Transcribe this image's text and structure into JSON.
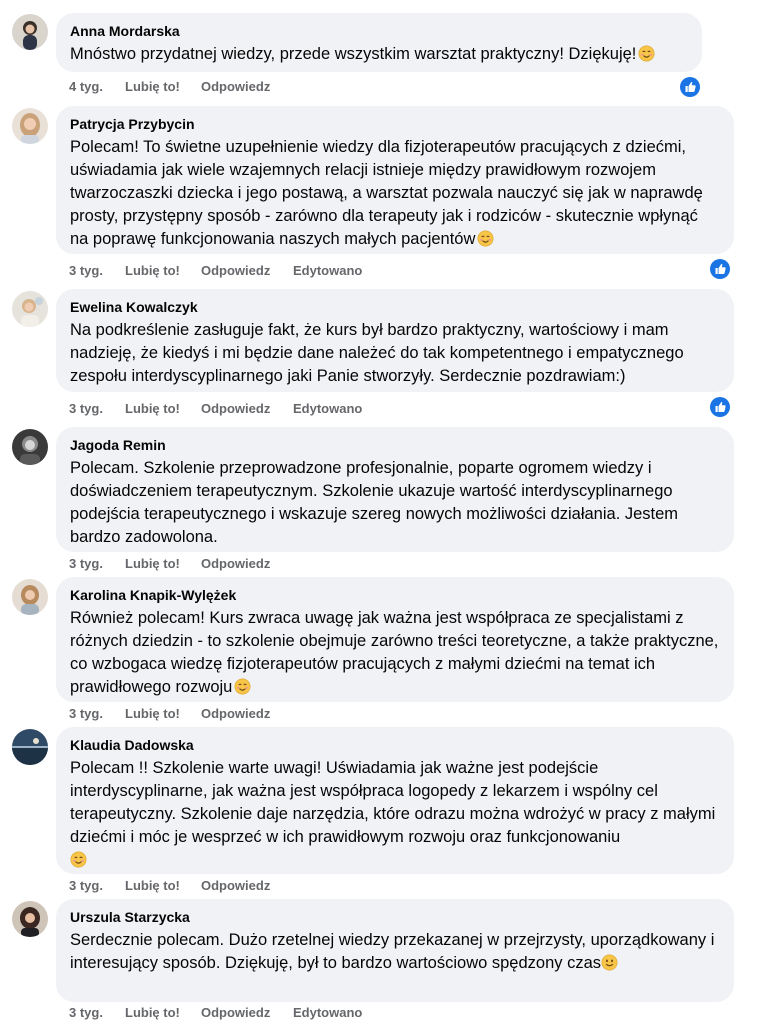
{
  "comments": [
    {
      "author": "Anna Mordarska",
      "text": "Mnóstwo przydatnej wiedzy, przede wszystkim warsztat praktyczny! Dziękuję!",
      "emoji": "smiling-face-icon",
      "time": "4 tyg.",
      "like_label": "Lubię to!",
      "reply_label": "Odpowiedz",
      "edited_label": "",
      "liked": true
    },
    {
      "author": "Patrycja Przybycin",
      "text": "Polecam! To świetne uzupełnienie wiedzy dla fizjoterapeutów pracujących z dziećmi, uświadamia jak wiele wzajemnych relacji istnieje między prawidłowym rozwojem twarzoczaszki dziecka i jego postawą, a warsztat pozwala nauczyć się jak w naprawdę prosty, przystępny sposób - zarówno dla terapeuty jak i rodziców - skutecznie wpłynąć na poprawę funkcjonowania naszych małych pacjentów",
      "emoji": "smiling-face-icon",
      "time": "3 tyg.",
      "like_label": "Lubię to!",
      "reply_label": "Odpowiedz",
      "edited_label": "Edytowano",
      "liked": true
    },
    {
      "author": "Ewelina Kowalczyk",
      "text": "Na podkreślenie zasługuje fakt, że kurs był bardzo praktyczny, wartościowy i mam nadzieję, że kiedyś i mi będzie dane należeć do tak kompetentnego i empatycznego zespołu interdyscyplinarnego jaki Panie stworzyły. Serdecznie pozdrawiam:)",
      "emoji": "",
      "time": "3 tyg.",
      "like_label": "Lubię to!",
      "reply_label": "Odpowiedz",
      "edited_label": "Edytowano",
      "liked": true
    },
    {
      "author": "Jagoda Remin",
      "text": "Polecam. Szkolenie przeprowadzone profesjonalnie, poparte ogromem wiedzy i doświadczeniem terapeutycznym. Szkolenie ukazuje wartość interdyscyplinarnego podejścia terapeutycznego i wskazuje szereg nowych możliwości działania. Jestem bardzo zadowolona.",
      "emoji": "",
      "time": "3 tyg.",
      "like_label": "Lubię to!",
      "reply_label": "Odpowiedz",
      "edited_label": "",
      "liked": false
    },
    {
      "author": "Karolina Knapik-Wylężek",
      "text": "Również polecam! Kurs zwraca uwagę jak ważna jest współpraca ze specjalistami z różnych dziedzin - to szkolenie obejmuje zarówno treści teoretyczne, a także praktyczne, co wzbogaca wiedzę fizjoterapeutów pracujących z małymi dziećmi na temat ich prawidłowego rozwoju",
      "emoji": "smiling-face-icon",
      "time": "3 tyg.",
      "like_label": "Lubię to!",
      "reply_label": "Odpowiedz",
      "edited_label": "",
      "liked": false
    },
    {
      "author": "Klaudia Dadowska",
      "text": "Polecam !! Szkolenie warte uwagi! Uświadamia jak ważne jest podejście interdyscyplinarne, jak ważna jest współpraca logopedy z lekarzem i wspólny cel terapeutyczny. Szkolenie daje narzędzia, które odrazu można wdrożyć w pracy z małymi dziećmi i móc je wesprzeć w ich prawidłowym rozwoju oraz funkcjonowaniu",
      "emoji": "smiling-face-icon",
      "time": "3 tyg.",
      "like_label": "Lubię to!",
      "reply_label": "Odpowiedz",
      "edited_label": "",
      "liked": false
    },
    {
      "author": "Urszula Starzycka",
      "text": "Serdecznie polecam. Dużo rzetelnej wiedzy przekazanej w przejrzysty, uporządkowany i interesujący sposób. Dziękuję, był to bardzo wartościowo spędzony czas",
      "emoji": "slightly-smiling-face-icon",
      "time": "3 tyg.",
      "like_label": "Lubię to!",
      "reply_label": "Odpowiedz",
      "edited_label": "Edytowano",
      "liked": false
    }
  ],
  "colors": {
    "bubble": "#f0f2f5",
    "meta": "#65676b",
    "like_badge": "#1b74e4",
    "text": "#050505"
  }
}
